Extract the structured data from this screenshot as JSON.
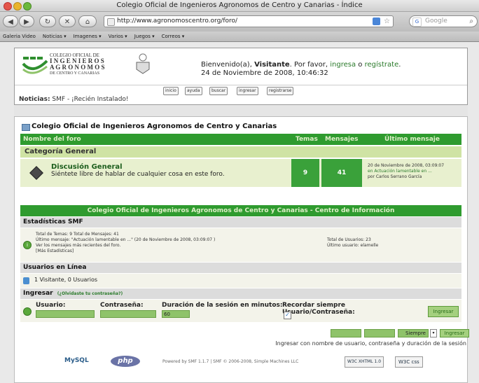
{
  "window": {
    "title": "Colegio Oficial de Ingenieros Agronomos de Centro y Canarias - Índice"
  },
  "toolbar": {
    "url": "http://www.agronomoscentro.org/foro/",
    "search_placeholder": "Google"
  },
  "bookmarks": [
    "Galeria Video",
    "Noticias ▾",
    "Imagenes ▾",
    "Varios ▾",
    "Juegos ▾",
    "Correos ▾"
  ],
  "header": {
    "logo": {
      "line1": "COLEGIO   OFICIAL   DE",
      "line2": "I N G E N I E R O S",
      "line3": "A G R O N O M O S",
      "line4": "DE CENTRO Y CANARIAS"
    },
    "welcome_prefix": "Bienvenido(a), ",
    "welcome_user": "Visitante",
    "welcome_mid": ". Por favor, ",
    "login_link": "ingresa",
    "welcome_or": " o ",
    "register_link": "regístrate",
    "welcome_end": ".",
    "date": "24 de Noviembre de 2008, 10:46:32",
    "menu": [
      "inicio",
      "ayuda",
      "buscar",
      "ingresar",
      "registrarse"
    ],
    "news_label": "Noticias:",
    "news_text": " SMF - ¡Recién Instalado!"
  },
  "board": {
    "section_title": "Colegio Oficial de Ingenieros Agronomos de Centro y Canarias",
    "columns": [
      "Nombre del foro",
      "Temas",
      "Mensajes",
      "Último mensaje"
    ],
    "category": "Categoría General",
    "forum": {
      "name": "Discusión General",
      "desc": "Siéntete libre de hablar de cualquier cosa en este foro.",
      "topics": "9",
      "posts": "41",
      "last_line1": "20 de Noviembre de 2008, 03:09:07",
      "last_line2": "en Actuación lamentable en ...",
      "last_line3": "por Carlos Serrano García"
    }
  },
  "info": {
    "header": "Colegio Oficial de Ingenieros Agronomos de Centro y Canarias - Centro de Información",
    "stats_title": "Estadísticas SMF",
    "stats_line1": "Total de Temas: 9   Total de Mensajes: 41",
    "stats_line2": "Último mensaje: \"Actuación lamentable en ...\" (20 de Noviembre de 2008, 03:09:07 )",
    "stats_line3": "Ver los mensajes más recientes del foro.",
    "stats_line4": "[Más Estadísticas]",
    "users_total": "Total de Usuarios: 23",
    "last_user": "Último usuario: elamelle",
    "online_title": "Usuarios en Línea",
    "online_text": "1 Visitante, 0 Usuarios",
    "login_title": "Ingresar",
    "forgot": "(¿Olvidaste tu contraseña?)",
    "user_label": "Usuario:",
    "pass_label": "Contraseña:",
    "duration_label": "Duración de la sesión en minutos:",
    "duration_value": "60",
    "remember_label": "Recordar siempre Usuario/Contraseña:",
    "login_button": "Ingresar"
  },
  "quicklogin": {
    "select_value": "Siempre",
    "button": "Ingresar",
    "caption": "Ingresar con nombre de usuario, contraseña y duración de la sesión"
  },
  "footer": {
    "mysql": "MySQL",
    "php": "php",
    "powered": "Powered by SMF 1.1.7 | SMF © 2006-2008, Simple Machines LLC",
    "xhtml": "W3C XHTML 1.0",
    "css": "W3C css"
  },
  "colors": {
    "header_green": "#2f9b2f",
    "category_green": "#cfe3a4",
    "number_green": "#3aa13a"
  }
}
